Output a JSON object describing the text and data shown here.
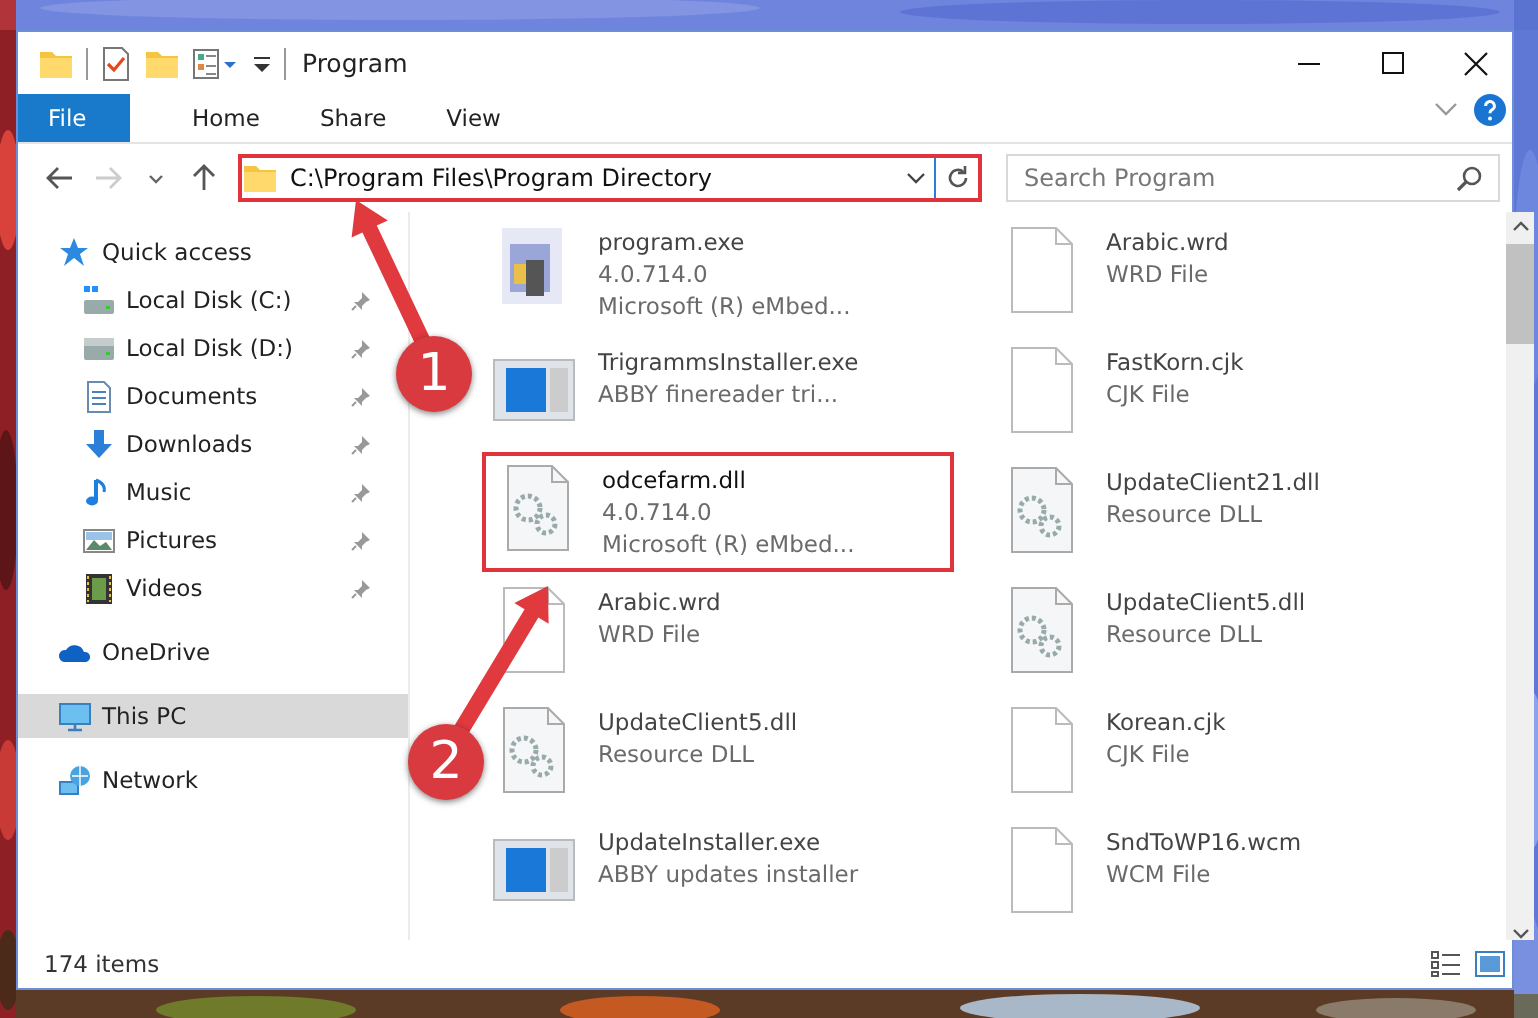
{
  "title_bar": {
    "title": "Program"
  },
  "ribbon": {
    "tabs": [
      {
        "label": "File",
        "kind": "file"
      },
      {
        "label": "Home",
        "kind": "tab"
      },
      {
        "label": "Share",
        "kind": "tab"
      },
      {
        "label": "View",
        "kind": "tab"
      }
    ]
  },
  "address_bar": {
    "path": "C:\\Program Files\\Program Directory",
    "highlighted": true
  },
  "search": {
    "placeholder": "Search Program"
  },
  "sidebar": {
    "items": [
      {
        "label": "Quick access",
        "kind": "star",
        "selected": false,
        "children": [
          {
            "label": "Local Disk (C:)",
            "kind": "system-drive",
            "pinned": true,
            "selected": false
          },
          {
            "label": "Local Disk (D:)",
            "kind": "drive",
            "pinned": true,
            "selected": false
          },
          {
            "label": "Documents",
            "kind": "documents",
            "pinned": true,
            "selected": false
          },
          {
            "label": "Downloads",
            "kind": "downloads",
            "pinned": true,
            "selected": false
          },
          {
            "label": "Music",
            "kind": "music",
            "pinned": true,
            "selected": false
          },
          {
            "label": "Pictures",
            "kind": "pictures",
            "pinned": true,
            "selected": false
          },
          {
            "label": "Videos",
            "kind": "videos",
            "pinned": true,
            "selected": false
          }
        ]
      },
      {
        "label": "OneDrive",
        "kind": "cloud",
        "selected": false
      },
      {
        "label": "This PC",
        "kind": "pc",
        "selected": true
      },
      {
        "label": "Network",
        "kind": "network",
        "selected": false
      }
    ]
  },
  "files": [
    {
      "name": "program.exe",
      "lines": [
        "4.0.714.0",
        "Microsoft (R) eMbed..."
      ],
      "kind": "exe",
      "highlighted": false
    },
    {
      "name": "Arabic.wrd",
      "lines": [
        "WRD File"
      ],
      "kind": "blank",
      "highlighted": false
    },
    {
      "name": "TrigrammsInstaller.exe",
      "lines": [
        "ABBY finereader tri..."
      ],
      "kind": "app",
      "highlighted": false
    },
    {
      "name": "FastKorn.cjk",
      "lines": [
        "CJK File"
      ],
      "kind": "blank",
      "highlighted": false
    },
    {
      "name": "odcefarm.dll",
      "lines": [
        "4.0.714.0",
        "Microsoft (R) eMbed..."
      ],
      "kind": "dll",
      "highlighted": true
    },
    {
      "name": "UpdateClient21.dll",
      "lines": [
        "Resource DLL"
      ],
      "kind": "dll",
      "highlighted": false
    },
    {
      "name": "Arabic.wrd",
      "lines": [
        "WRD File"
      ],
      "kind": "blank",
      "highlighted": false
    },
    {
      "name": "UpdateClient5.dll",
      "lines": [
        "Resource DLL"
      ],
      "kind": "dll",
      "highlighted": false
    },
    {
      "name": "UpdateClient5.dll",
      "lines": [
        "Resource DLL"
      ],
      "kind": "dll",
      "highlighted": false
    },
    {
      "name": "Korean.cjk",
      "lines": [
        "CJK File"
      ],
      "kind": "blank",
      "highlighted": false
    },
    {
      "name": "UpdateInstaller.exe",
      "lines": [
        "ABBY updates installer"
      ],
      "kind": "app",
      "highlighted": false
    },
    {
      "name": "SndToWP16.wcm",
      "lines": [
        "WCM File"
      ],
      "kind": "blank",
      "highlighted": false
    }
  ],
  "status_bar": {
    "count": "174 items"
  },
  "annotations": [
    {
      "label": "1"
    },
    {
      "label": "2"
    }
  ]
}
